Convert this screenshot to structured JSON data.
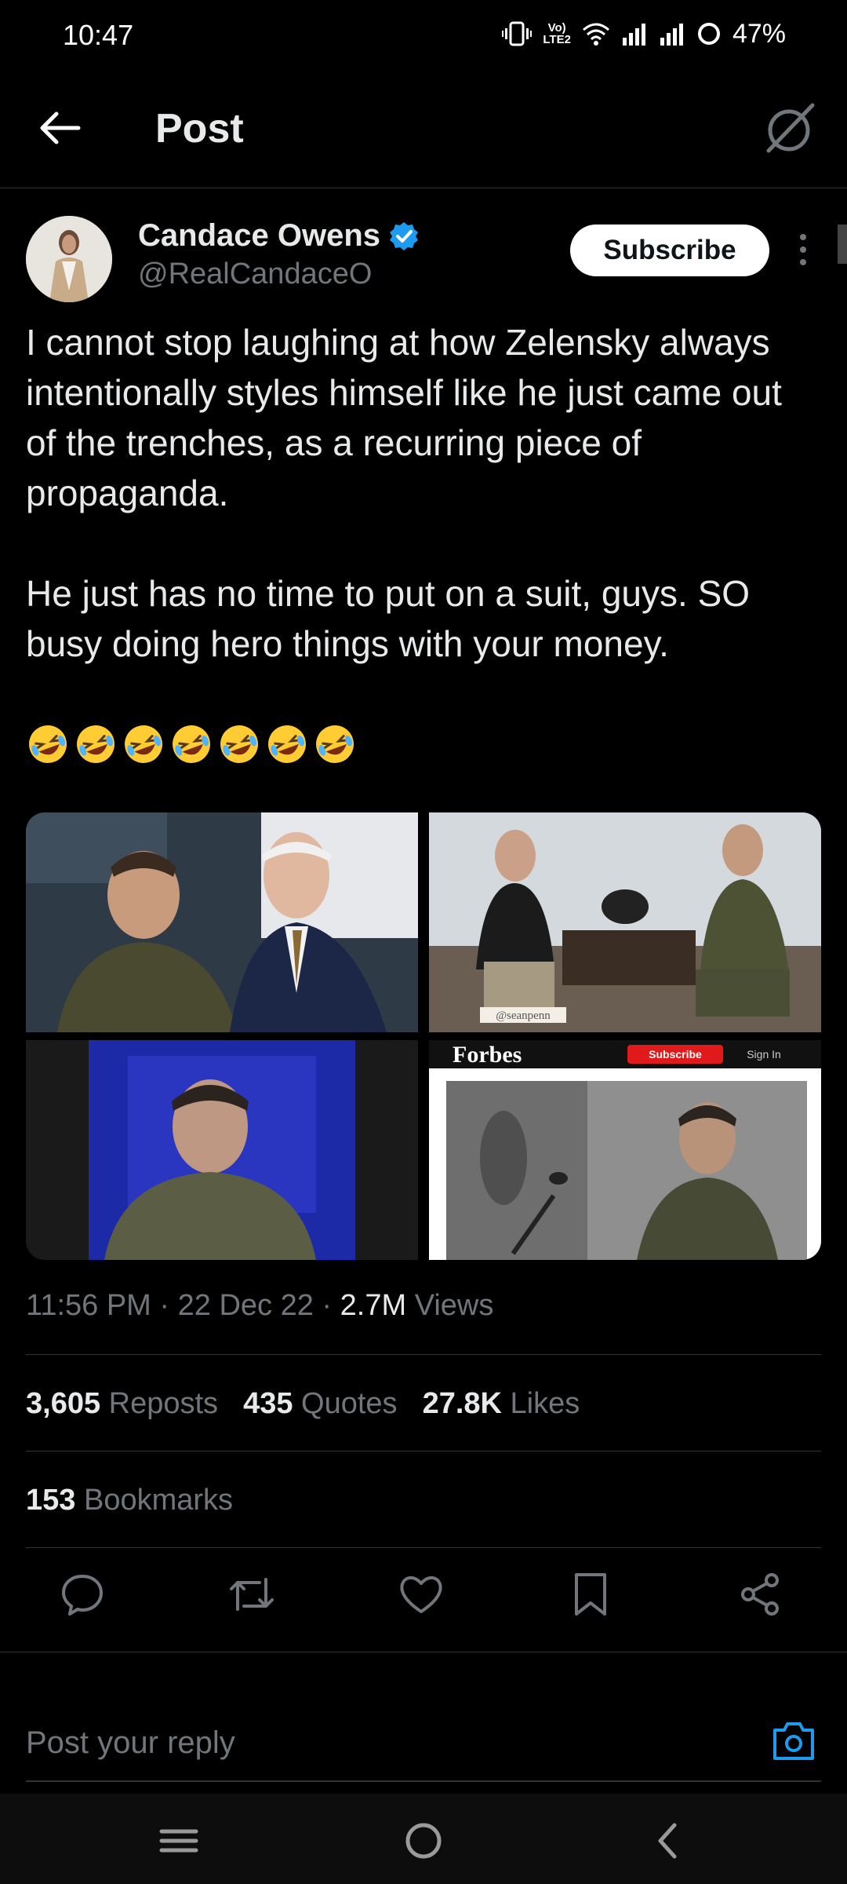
{
  "status_bar": {
    "time": "10:47",
    "lte_line1": "Vo)",
    "lte_line2": "LTE2",
    "battery": "47%"
  },
  "header": {
    "title": "Post",
    "back_icon": "arrow-left-icon",
    "grok_icon": "grok-icon"
  },
  "author": {
    "name": "Candace Owens",
    "handle": "@RealCandaceO",
    "verified": true,
    "verified_color": "#1d9bf0",
    "subscribe_label": "Subscribe"
  },
  "post": {
    "paragraph1": "I cannot stop laughing at how Zelensky always intentionally styles himself like he just came out of the trenches, as a recurring piece of propaganda.",
    "paragraph2": "He just has no time to put on a suit, guys. SO busy doing hero things with your money.",
    "emoji_name": "rolling-on-the-floor-laughing-emoji",
    "emoji_count": 7
  },
  "media": {
    "watermark": "@seanpenn",
    "forbes_logo": "Forbes",
    "forbes_subscribe": "Subscribe",
    "forbes_signin": "Sign In"
  },
  "meta": {
    "time": "11:56 PM",
    "date": "22 Dec 22",
    "views_count": "2.7M",
    "views_label": "Views"
  },
  "stats": {
    "reposts_count": "3,605",
    "reposts_label": "Reposts",
    "quotes_count": "435",
    "quotes_label": "Quotes",
    "likes_count": "27.8K",
    "likes_label": "Likes",
    "bookmarks_count": "153",
    "bookmarks_label": "Bookmarks"
  },
  "actions": [
    "reply-icon",
    "repost-icon",
    "like-icon",
    "bookmark-icon",
    "share-icon"
  ],
  "reply": {
    "placeholder": "Post your reply",
    "camera_icon": "camera-icon",
    "accent": "#1d9bf0"
  },
  "nav": [
    "recent-apps-icon",
    "home-icon",
    "back-icon"
  ]
}
